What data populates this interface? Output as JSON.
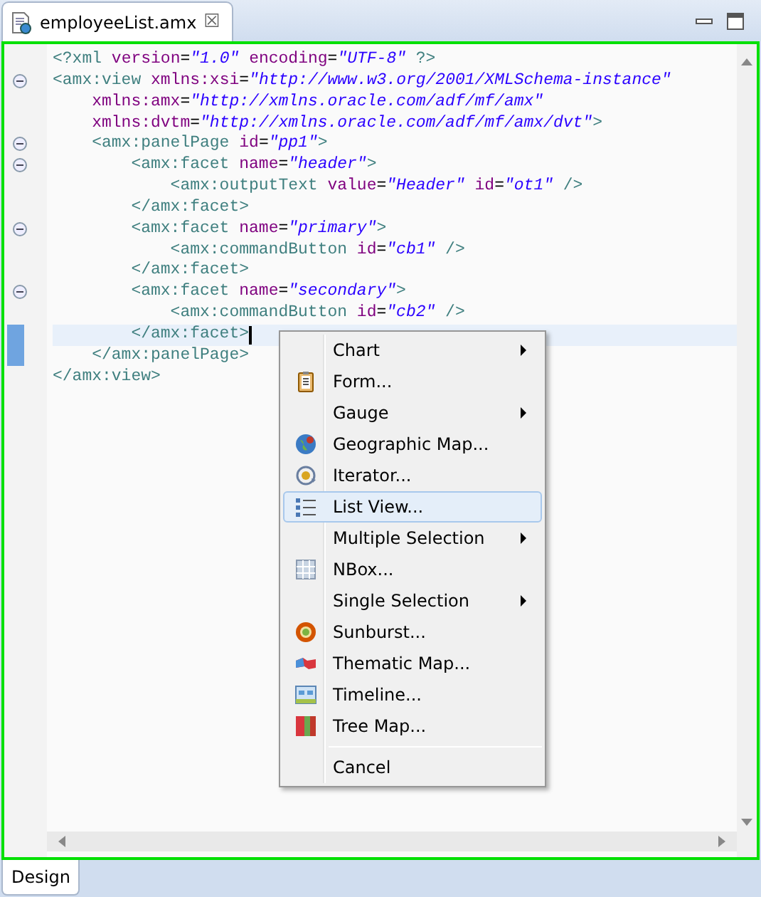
{
  "editor_tab": {
    "title": "employeeList.amx",
    "close": "☒"
  },
  "code_lines": [
    {
      "fold": false,
      "current": false,
      "segments": [
        {
          "kind": "tag",
          "t": "<?xml "
        },
        {
          "kind": "attr",
          "t": "version"
        },
        {
          "kind": "plain",
          "t": "="
        },
        {
          "kind": "value",
          "t": "\"1.0\" "
        },
        {
          "kind": "attr",
          "t": "encoding"
        },
        {
          "kind": "plain",
          "t": "="
        },
        {
          "kind": "value",
          "t": "\"UTF-8\""
        },
        {
          "kind": "tag",
          "t": " ?>"
        }
      ]
    },
    {
      "fold": true,
      "current": false,
      "segments": [
        {
          "kind": "tag",
          "t": "<amx:view "
        },
        {
          "kind": "attr",
          "t": "xmlns:xsi"
        },
        {
          "kind": "plain",
          "t": "="
        },
        {
          "kind": "value",
          "t": "\"http://www.w3.org/2001/XMLSchema-instance\""
        }
      ],
      "children": [
        {
          "fold": false,
          "current": false,
          "segments": [
            {
              "kind": "attr",
              "t": "xmlns:amx"
            },
            {
              "kind": "plain",
              "t": "="
            },
            {
              "kind": "value",
              "t": "\"http://xmlns.oracle.com/adf/mf/amx\""
            }
          ]
        },
        {
          "fold": false,
          "current": false,
          "segments": [
            {
              "kind": "attr",
              "t": "xmlns:dvtm"
            },
            {
              "kind": "plain",
              "t": "="
            },
            {
              "kind": "value",
              "t": "\"http://xmlns.oracle.com/adf/mf/amx/dvt\""
            },
            {
              "kind": "tag",
              "t": ">"
            }
          ]
        },
        {
          "fold": true,
          "current": false,
          "segments": [
            {
              "kind": "tag",
              "t": "<amx:panelPage "
            },
            {
              "kind": "attr",
              "t": "id"
            },
            {
              "kind": "plain",
              "t": "="
            },
            {
              "kind": "value",
              "t": "\"pp1\""
            },
            {
              "kind": "tag",
              "t": ">"
            }
          ],
          "children": [
            {
              "fold": true,
              "current": false,
              "segments": [
                {
                  "kind": "tag",
                  "t": "<amx:facet "
                },
                {
                  "kind": "attr",
                  "t": "name"
                },
                {
                  "kind": "plain",
                  "t": "="
                },
                {
                  "kind": "value",
                  "t": "\"header\""
                },
                {
                  "kind": "tag",
                  "t": ">"
                }
              ],
              "children": [
                {
                  "fold": false,
                  "current": false,
                  "segments": [
                    {
                      "kind": "tag",
                      "t": "<amx:outputText "
                    },
                    {
                      "kind": "attr",
                      "t": "value"
                    },
                    {
                      "kind": "plain",
                      "t": "="
                    },
                    {
                      "kind": "value",
                      "t": "\"Header\" "
                    },
                    {
                      "kind": "attr",
                      "t": "id"
                    },
                    {
                      "kind": "plain",
                      "t": "="
                    },
                    {
                      "kind": "value",
                      "t": "\"ot1\""
                    },
                    {
                      "kind": "tag",
                      "t": " />"
                    }
                  ]
                }
              ]
            },
            {
              "fold": false,
              "current": false,
              "segments": [
                {
                  "kind": "tag",
                  "t": "</amx:facet>"
                }
              ]
            },
            {
              "fold": true,
              "current": false,
              "segments": [
                {
                  "kind": "tag",
                  "t": "<amx:facet "
                },
                {
                  "kind": "attr",
                  "t": "name"
                },
                {
                  "kind": "plain",
                  "t": "="
                },
                {
                  "kind": "value",
                  "t": "\"primary\""
                },
                {
                  "kind": "tag",
                  "t": ">"
                }
              ],
              "children": [
                {
                  "fold": false,
                  "current": false,
                  "segments": [
                    {
                      "kind": "tag",
                      "t": "<amx:commandButton "
                    },
                    {
                      "kind": "attr",
                      "t": "id"
                    },
                    {
                      "kind": "plain",
                      "t": "="
                    },
                    {
                      "kind": "value",
                      "t": "\"cb1\""
                    },
                    {
                      "kind": "tag",
                      "t": " />"
                    }
                  ]
                }
              ]
            },
            {
              "fold": false,
              "current": false,
              "segments": [
                {
                  "kind": "tag",
                  "t": "</amx:facet>"
                }
              ]
            },
            {
              "fold": true,
              "current": false,
              "segments": [
                {
                  "kind": "tag",
                  "t": "<amx:facet "
                },
                {
                  "kind": "attr",
                  "t": "name"
                },
                {
                  "kind": "plain",
                  "t": "="
                },
                {
                  "kind": "value",
                  "t": "\"secondary\""
                },
                {
                  "kind": "tag",
                  "t": ">"
                }
              ],
              "children": [
                {
                  "fold": false,
                  "current": false,
                  "segments": [
                    {
                      "kind": "tag",
                      "t": "<amx:commandButton "
                    },
                    {
                      "kind": "attr",
                      "t": "id"
                    },
                    {
                      "kind": "plain",
                      "t": "="
                    },
                    {
                      "kind": "value",
                      "t": "\"cb2\""
                    },
                    {
                      "kind": "tag",
                      "t": " />"
                    }
                  ]
                }
              ]
            },
            {
              "fold": false,
              "current": true,
              "segments": [
                {
                  "kind": "tag",
                  "t": "</amx:facet>"
                }
              ]
            }
          ]
        },
        {
          "fold": false,
          "current": false,
          "segments": [
            {
              "kind": "tag",
              "t": "</amx:panelPage>"
            }
          ]
        }
      ]
    },
    {
      "fold": false,
      "current": false,
      "segments": [
        {
          "kind": "tag",
          "t": "</amx:view>"
        }
      ]
    }
  ],
  "context_menu": [
    {
      "label": "Chart",
      "submenu": true,
      "selected": false
    },
    {
      "label": "Form...",
      "submenu": false,
      "selected": false
    },
    {
      "label": "Gauge",
      "submenu": true,
      "selected": false
    },
    {
      "label": "Geographic Map...",
      "submenu": false,
      "selected": false
    },
    {
      "label": "Iterator...",
      "submenu": false,
      "selected": false
    },
    {
      "label": "List View...",
      "submenu": false,
      "selected": true
    },
    {
      "label": "Multiple Selection",
      "submenu": true,
      "selected": false
    },
    {
      "label": "NBox...",
      "submenu": false,
      "selected": false
    },
    {
      "label": "Single Selection",
      "submenu": true,
      "selected": false
    },
    {
      "label": "Sunburst...",
      "submenu": false,
      "selected": false
    },
    {
      "label": "Thematic Map...",
      "submenu": false,
      "selected": false
    },
    {
      "label": "Timeline...",
      "submenu": false,
      "selected": false
    },
    {
      "label": "Tree Map...",
      "submenu": false,
      "selected": false
    },
    {
      "label": "Cancel",
      "submenu": false,
      "selected": false,
      "separator_before": true
    }
  ],
  "bottom_tabs": [
    {
      "label": "Design",
      "selected": true
    }
  ]
}
